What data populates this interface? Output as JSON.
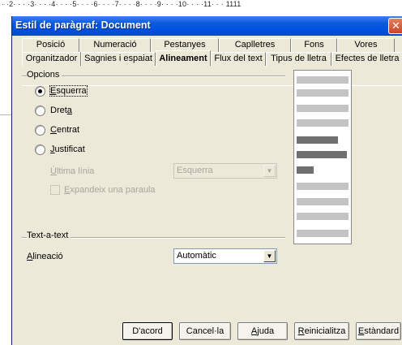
{
  "ruler": {
    "text": "· ·2· · · ·3· · · ·4· · · ·5· · · ·6· · · ·7· · · ·8· · · ·9· · · ·10· · · ·11· · · 1111"
  },
  "dialog": {
    "title": "Estil de paràgraf: Document",
    "close_glyph": "✕"
  },
  "tabs": {
    "back_row": [
      "Posició",
      "Numeració",
      "Pestanyes",
      "Caplletres",
      "Fons",
      "Vores"
    ],
    "front_row": [
      "Organitzador",
      "Sagnies i espaiat",
      "Alineament",
      "Flux del text",
      "Tipus de lletra",
      "Efectes de lletra"
    ],
    "active": "Alineament"
  },
  "options": {
    "group_label": "Opcions",
    "radios": [
      {
        "label_pre": "",
        "label_u": "E",
        "label_post": "squerra",
        "checked": true
      },
      {
        "label_pre": "Dret",
        "label_u": "a",
        "label_post": "",
        "checked": false
      },
      {
        "label_pre": "",
        "label_u": "C",
        "label_post": "entrat",
        "checked": false
      },
      {
        "label_pre": "",
        "label_u": "J",
        "label_post": "ustificat",
        "checked": false
      }
    ],
    "last_line_label_u": "Ú",
    "last_line_label_post": "ltima línia",
    "last_line_value": "Esquerra",
    "expand_u": "E",
    "expand_post": "xpandeix una paraula"
  },
  "text_to_text": {
    "group_label": "Text-a-text",
    "align_label_u": "A",
    "align_label_post": "lineació",
    "align_value": "Automàtic"
  },
  "buttons": {
    "ok": "D'acord",
    "cancel": "Cancel·la",
    "help_u": "A",
    "help_post": "juda",
    "reset_u": "R",
    "reset_post": "einicialitza",
    "standard_u": "E",
    "standard_post": "stàndard"
  },
  "colors": {
    "titlebar": "#0050e0",
    "dialog_bg": "#ece9d8",
    "preview_light": "#c4c4c4",
    "preview_dark": "#6f6f6f"
  }
}
